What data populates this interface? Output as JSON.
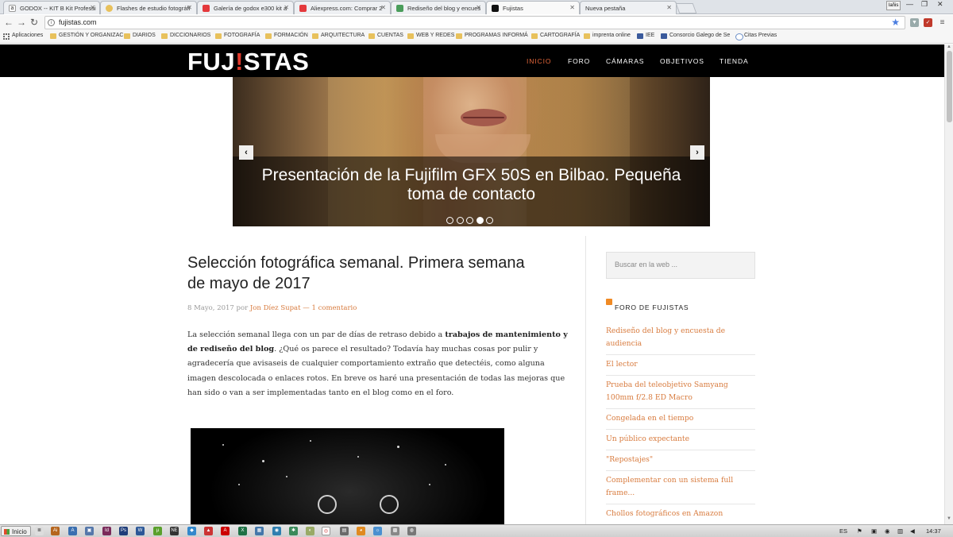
{
  "browser": {
    "tabs": [
      {
        "label": "GODOX -- KIT B Kit Professi",
        "favicon": "amazon-icon",
        "color": "#000000"
      },
      {
        "label": "Flashes de estudio fotográfi",
        "favicon": "bulb-icon",
        "color": "#e8c15c"
      },
      {
        "label": "Galería de godox e300 kit a",
        "favicon": "aliexpress-icon",
        "color": "#e4393c"
      },
      {
        "label": "Aliexpress.com: Comprar 2",
        "favicon": "aliexpress-icon",
        "color": "#e4393c"
      },
      {
        "label": "Rediseño del blog y encues",
        "favicon": "doc-icon",
        "color": "#4a9d5b"
      },
      {
        "label": "Fujistas",
        "favicon": "fujistas-icon",
        "color": "#111111"
      },
      {
        "label": "Nueva pestaña",
        "favicon": "none",
        "color": "#cccccc"
      }
    ],
    "active_tab_index": 5,
    "user_button": "Iañis",
    "url": "fujistas.com",
    "bookmarks": [
      {
        "label": "Aplicaciones",
        "kind": "apps"
      },
      {
        "label": "GESTIÓN Y ORGANIZAC",
        "kind": "folder"
      },
      {
        "label": "DIARIOS",
        "kind": "folder"
      },
      {
        "label": "DICCIONARIOS",
        "kind": "folder"
      },
      {
        "label": "FOTOGRAFÍA",
        "kind": "folder"
      },
      {
        "label": "FORMACIÓN",
        "kind": "folder"
      },
      {
        "label": "ARQUITECTURA",
        "kind": "folder"
      },
      {
        "label": "CUENTAS",
        "kind": "folder"
      },
      {
        "label": "WEB Y REDES",
        "kind": "folder"
      },
      {
        "label": "PROGRAMAS INFORMÁ",
        "kind": "folder"
      },
      {
        "label": "CARTOGRAFÍA",
        "kind": "folder"
      },
      {
        "label": "imprenta online",
        "kind": "folder"
      },
      {
        "label": "IEE",
        "kind": "logo"
      },
      {
        "label": "Consorcio Galego de Se",
        "kind": "logo"
      },
      {
        "label": "Citas Previas",
        "kind": "globe"
      }
    ]
  },
  "site": {
    "logo_part1": "FUJ",
    "logo_excl": "!",
    "logo_part2": "STAS",
    "menu": [
      "INICIO",
      "FORO",
      "CÁMARAS",
      "OBJETIVOS",
      "TIENDA"
    ],
    "active_menu": "INICIO",
    "accent_color": "#e4663a"
  },
  "slider": {
    "caption": "Presentación de la Fujifilm GFX 50S en Bilbao. Pequeña toma de contacto",
    "prev_icon": "‹",
    "next_icon": "›",
    "dot_count": 5,
    "active_dot": 3
  },
  "post": {
    "title": "Selección fotográfica semanal. Primera semana de mayo de 2017",
    "date": "8 Mayo, 2017",
    "by": "por",
    "author": "Jon Díez Supat",
    "sep": "—",
    "comments": "1 comentario",
    "body_1": "La selección semanal llega con un par de días de retraso debido a ",
    "body_bold": "trabajos de mantenimiento y de rediseño del blog",
    "body_2": ". ¿Qué os parece el resultado? Todavía hay muchas cosas por pulir y agradecería que avisaseis de cualquier comportamiento extraño que detectéis, como alguna imagen descolocada o enlaces rotos. En breve os haré una presentación de todas las mejoras que han sido o van a ser implementadas tanto en el blog como en el foro."
  },
  "sidebar": {
    "search_placeholder": "Buscar en la web ...",
    "widget_title": "FORO DE FUJISTAS",
    "feed": [
      "Rediseño del blog y encuesta de audiencia",
      "El lector",
      "Prueba del teleobjetivo Samyang 100mm f/2.8 ED Macro",
      "Congelada en el tiempo",
      "Un público expectante",
      "\"Repostajes\"",
      "Complementar con un sistema full frame...",
      "Chollos fotográficos en Amazon"
    ],
    "link_color": "#d87b3e"
  },
  "taskbar": {
    "start_label": "Inicio",
    "language": "ES",
    "clock": "14:37"
  }
}
